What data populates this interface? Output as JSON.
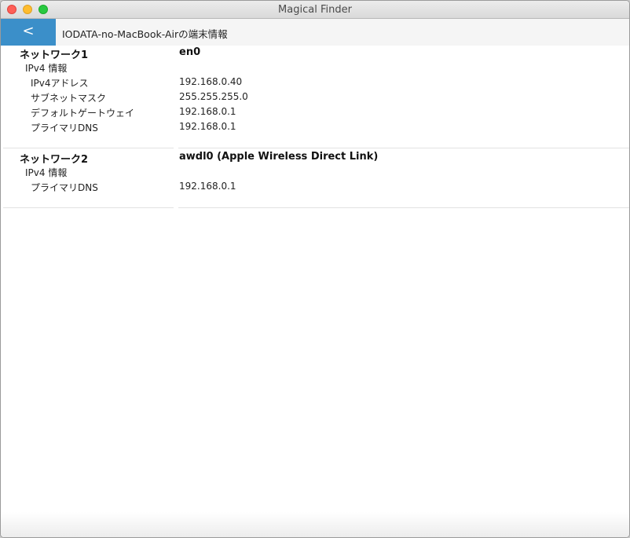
{
  "window": {
    "title": "Magical Finder"
  },
  "navbar": {
    "back_label": "<",
    "title": "IODATA-no-MacBook-Airの端末情報"
  },
  "networks": [
    {
      "label": "ネットワーク1",
      "interface": "en0",
      "group_label": "IPv4 情報",
      "rows": [
        {
          "label": "IPv4アドレス",
          "value": "192.168.0.40"
        },
        {
          "label": "サブネットマスク",
          "value": "255.255.255.0"
        },
        {
          "label": "デフォルトゲートウェイ",
          "value": "192.168.0.1"
        },
        {
          "label": "プライマリDNS",
          "value": "192.168.0.1"
        }
      ]
    },
    {
      "label": "ネットワーク2",
      "interface": "awdl0 (Apple Wireless Direct Link)",
      "group_label": "IPv4 情報",
      "rows": [
        {
          "label": "プライマリDNS",
          "value": "192.168.0.1"
        }
      ]
    }
  ],
  "colors": {
    "accent": "#3b8fc9",
    "close": "#fe5f57",
    "minimize": "#febc2e",
    "maximize": "#28c840"
  }
}
